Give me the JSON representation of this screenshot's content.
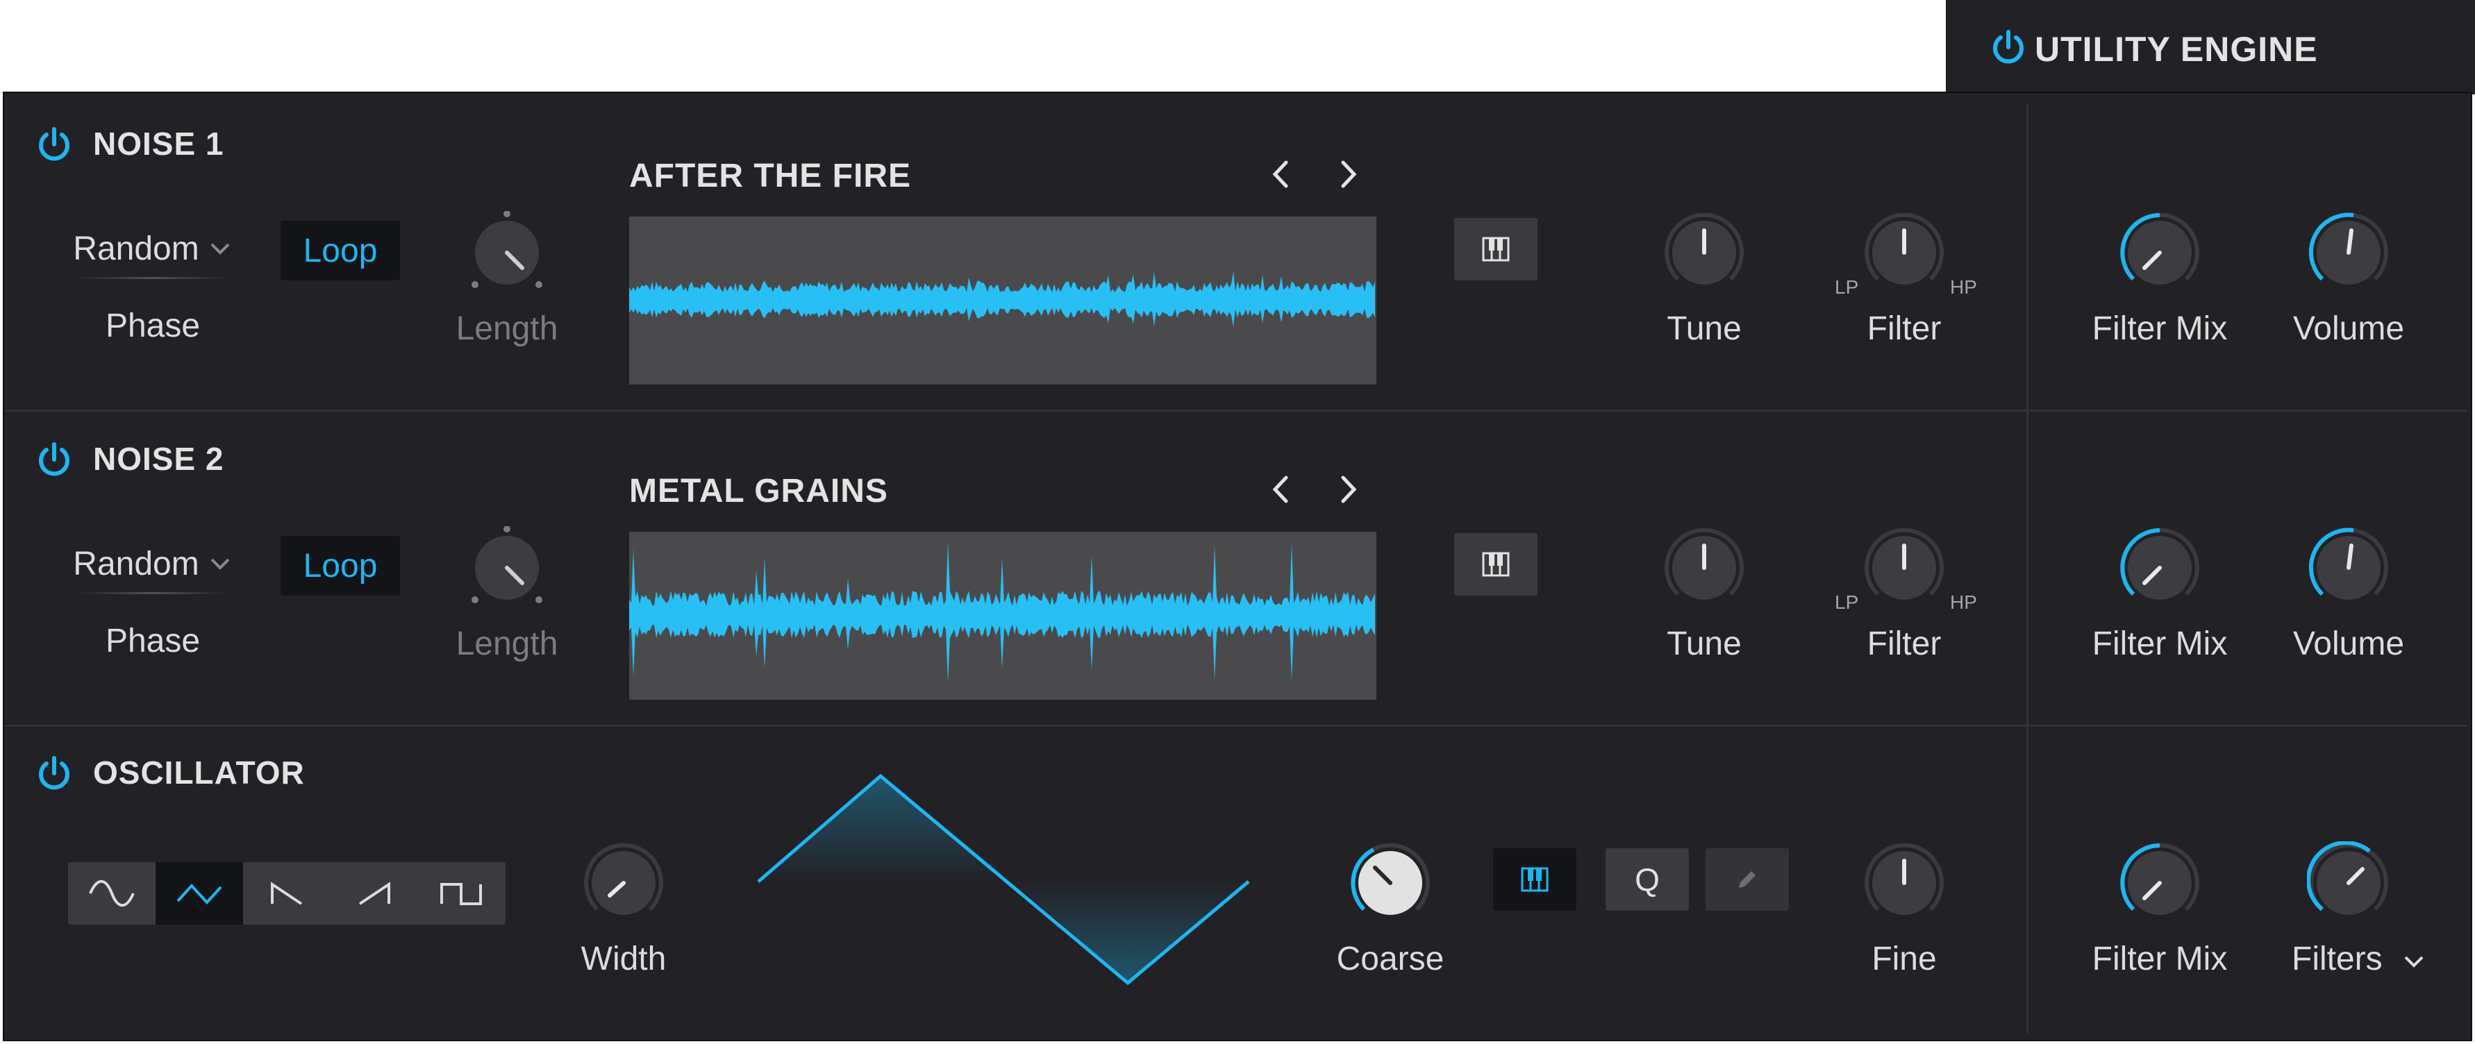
{
  "header": {
    "title": "UTILITY ENGINE"
  },
  "colors": {
    "accent": "#1fb5f0",
    "panel": "#222226",
    "wave_bg": "#4a4a4d"
  },
  "noise1": {
    "title": "NOISE 1",
    "phase_mode": "Random",
    "phase_label": "Phase",
    "loop_label": "Loop",
    "length_label": "Length",
    "sample_name": "AFTER THE FIRE",
    "tune_label": "Tune",
    "filter_label": "Filter",
    "filter_lp": "LP",
    "filter_hp": "HP",
    "filter_mix_label": "Filter Mix",
    "volume_label": "Volume",
    "icons": {
      "power": "power-icon",
      "prev": "chevron-left-icon",
      "next": "chevron-right-icon",
      "keyboard": "keyboard-icon"
    }
  },
  "noise2": {
    "title": "NOISE 2",
    "phase_mode": "Random",
    "phase_label": "Phase",
    "loop_label": "Loop",
    "length_label": "Length",
    "sample_name": "METAL GRAINS",
    "tune_label": "Tune",
    "filter_label": "Filter",
    "filter_lp": "LP",
    "filter_hp": "HP",
    "filter_mix_label": "Filter Mix",
    "volume_label": "Volume"
  },
  "oscillator": {
    "title": "OSCILLATOR",
    "shapes": [
      "sine-wave-icon",
      "triangle-wave-icon",
      "ramp-down-icon",
      "saw-wave-icon",
      "square-wave-icon"
    ],
    "selected_shape": "triangle-wave-icon",
    "width_label": "Width",
    "coarse_label": "Coarse",
    "q_label": "Q",
    "fine_label": "Fine",
    "filter_mix_label": "Filter Mix",
    "filters_label": "Filters"
  }
}
